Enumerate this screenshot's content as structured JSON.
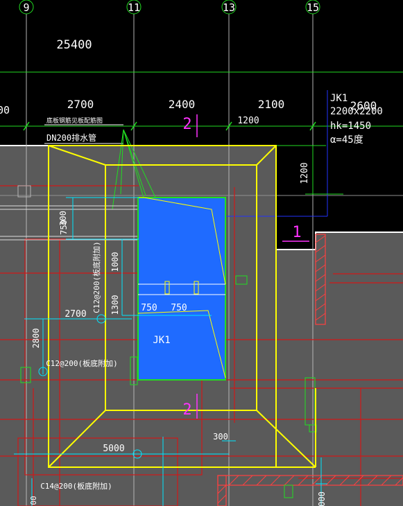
{
  "colors": {
    "background_top": "#000000",
    "slab_fill": "#5a5a5a",
    "grid_line": "#b5b5b5",
    "dim_white": "#ffffff",
    "dim_cyan": "#00e5ff",
    "outline_yellow": "#ffff00",
    "rebar_red": "#d01818",
    "leader_green": "#22dd22",
    "pit_blue": "#1f6bff",
    "section_magenta": "#ff33ff",
    "ref_blue": "#2233ff",
    "hatch_red": "#ff4040"
  },
  "grid_axes": [
    "9",
    "11",
    "13",
    "15"
  ],
  "top_dims": {
    "overall": "25400",
    "spans": [
      "2700",
      "2400",
      "2100",
      "2600"
    ],
    "left_partial": "00"
  },
  "notes": {
    "rebar_note": "底板钢筋见板配筋图",
    "pipe_note": "DN200排水管",
    "sump_tag": "JK1",
    "sump_size": "2200x2200",
    "sump_hk": "hk=1450",
    "sump_angle": "α=45度"
  },
  "dims": {
    "d1200_h": "1200",
    "d1200_v": "1200",
    "d300": "300",
    "d750_v": "750",
    "d1000": "1000",
    "d1300": "1300",
    "d750_a": "750",
    "d750_b": "750",
    "d2700": "2700",
    "d2800": "2800",
    "d5000": "5000",
    "d300_b": "300",
    "d000": "000",
    "d00": "00"
  },
  "rebar_labels": {
    "r1": "C12@200(板底附加)",
    "r2": "C12@200(板底附加)",
    "r3": "C14@200(板底附加)"
  },
  "section_marks": {
    "s1": "1",
    "s2_top": "2",
    "s2_bottom": "2"
  }
}
